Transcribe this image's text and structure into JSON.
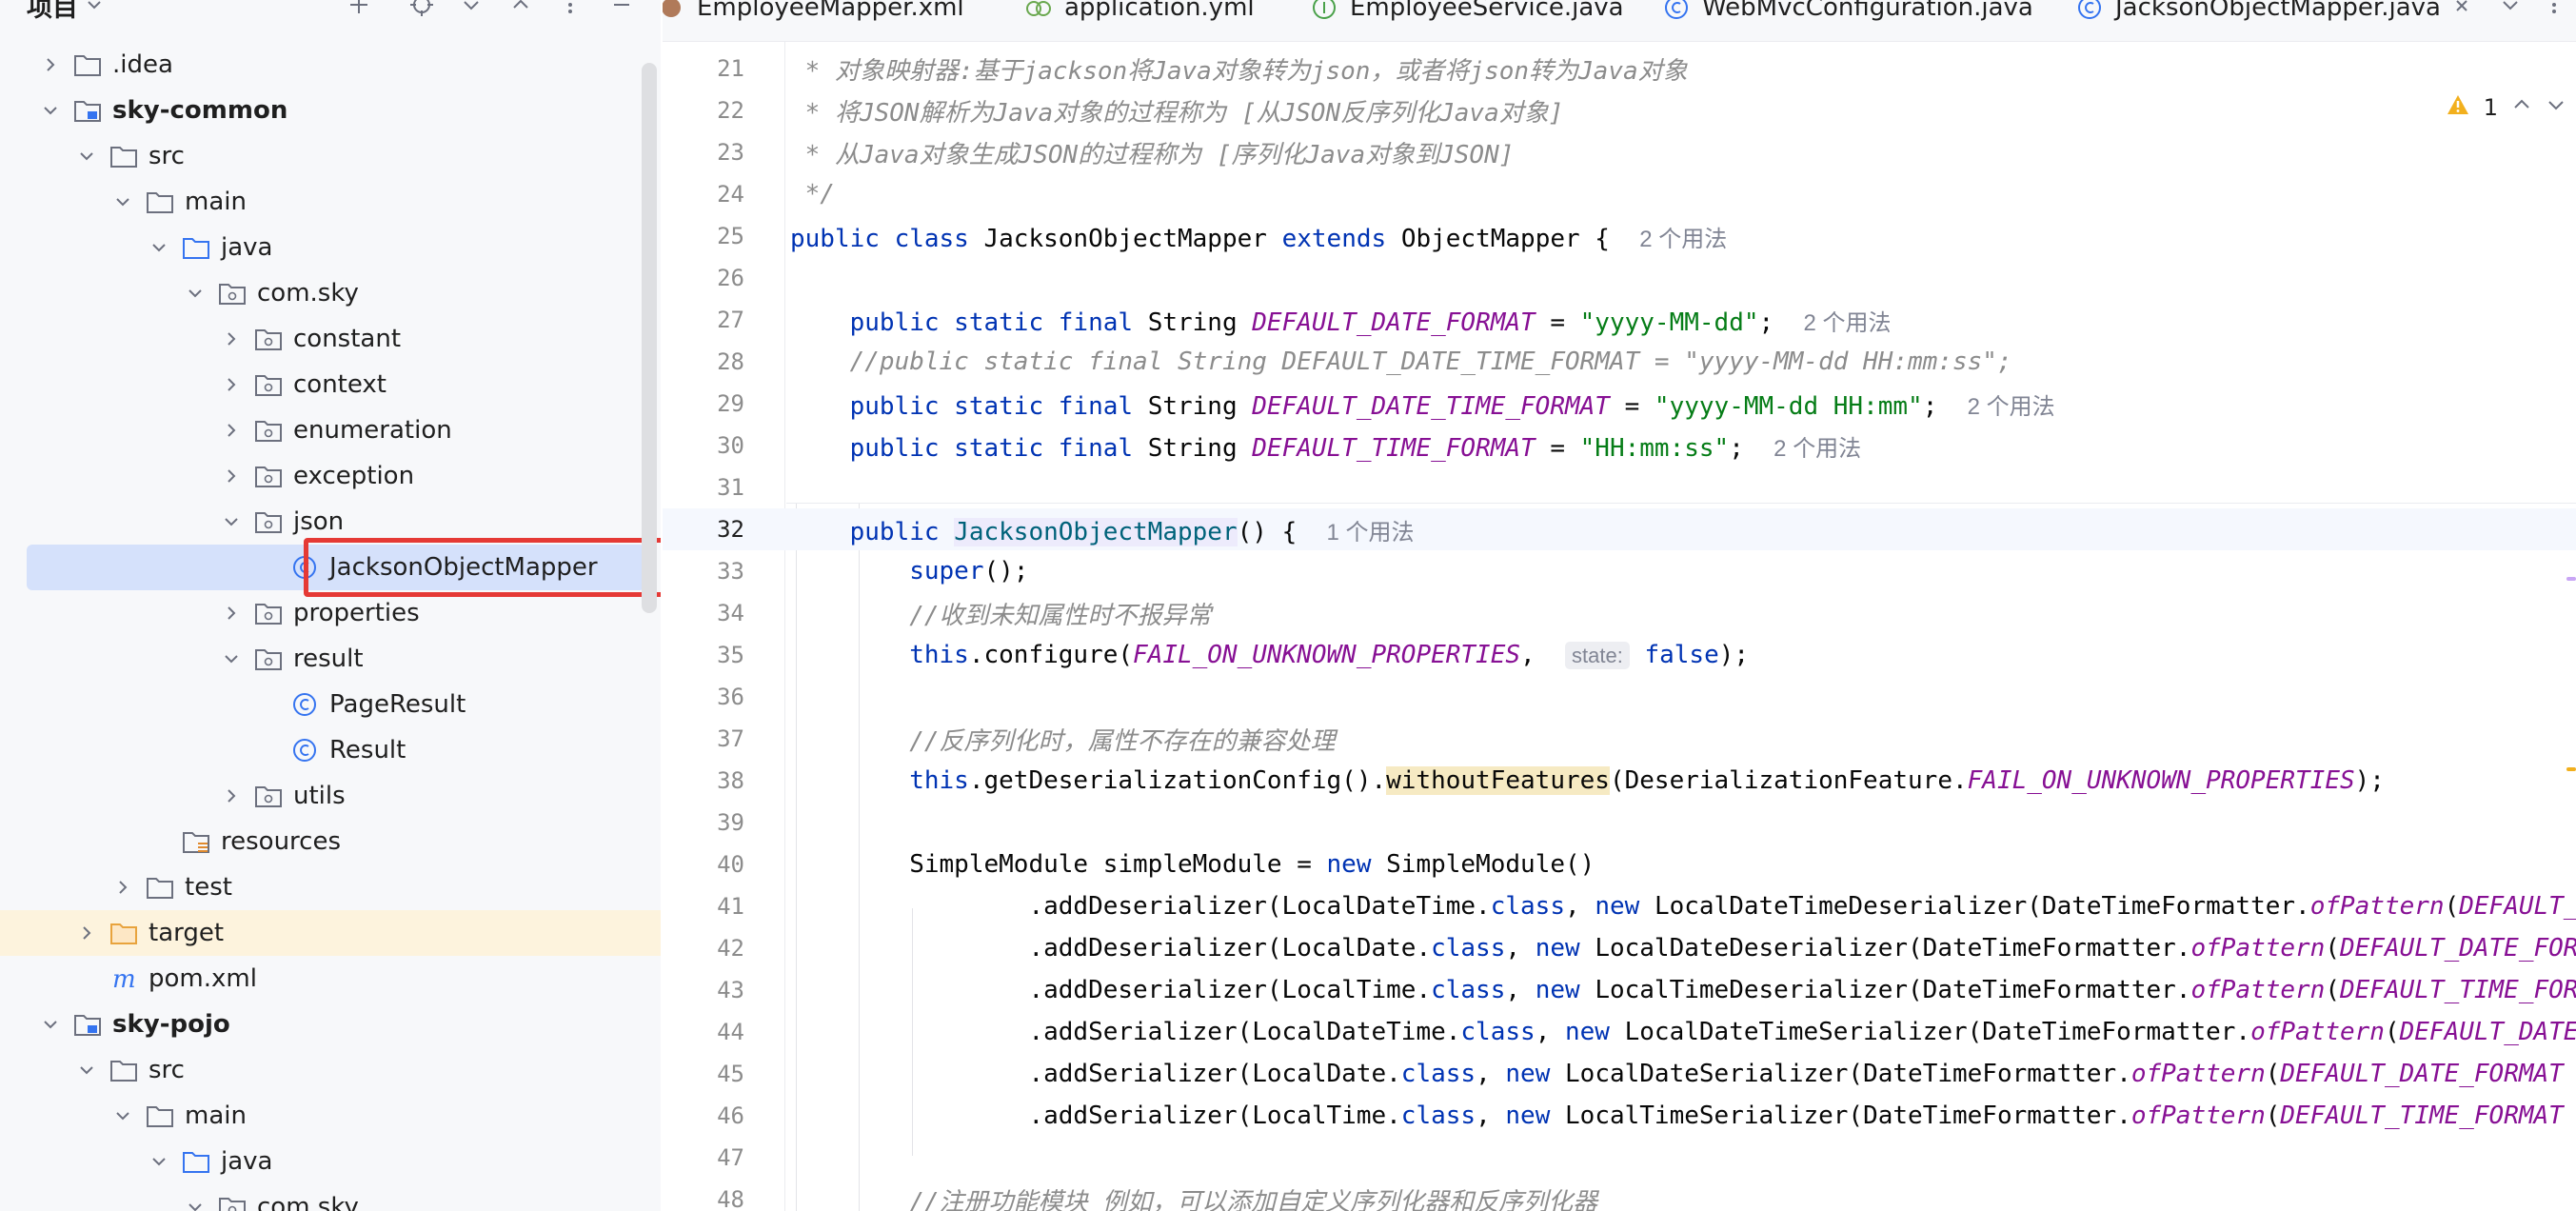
{
  "project_panel": {
    "title": "项目",
    "tree": [
      {
        "label": ".idea",
        "indent": 1,
        "chevron": "right",
        "icon": "folder"
      },
      {
        "label": "sky-common",
        "indent": 1,
        "chevron": "down",
        "icon": "module",
        "bold": true
      },
      {
        "label": "src",
        "indent": 2,
        "chevron": "down",
        "icon": "folder"
      },
      {
        "label": "main",
        "indent": 3,
        "chevron": "down",
        "icon": "folder"
      },
      {
        "label": "java",
        "indent": 4,
        "chevron": "down",
        "icon": "source-folder"
      },
      {
        "label": "com.sky",
        "indent": 5,
        "chevron": "down",
        "icon": "package"
      },
      {
        "label": "constant",
        "indent": 6,
        "chevron": "right",
        "icon": "package"
      },
      {
        "label": "context",
        "indent": 6,
        "chevron": "right",
        "icon": "package"
      },
      {
        "label": "enumeration",
        "indent": 6,
        "chevron": "right",
        "icon": "package"
      },
      {
        "label": "exception",
        "indent": 6,
        "chevron": "right",
        "icon": "package"
      },
      {
        "label": "json",
        "indent": 6,
        "chevron": "down",
        "icon": "package"
      },
      {
        "label": "JacksonObjectMapper",
        "indent": 7,
        "chevron": "none",
        "icon": "class",
        "selected": true
      },
      {
        "label": "properties",
        "indent": 6,
        "chevron": "right",
        "icon": "package"
      },
      {
        "label": "result",
        "indent": 6,
        "chevron": "down",
        "icon": "package"
      },
      {
        "label": "PageResult",
        "indent": 7,
        "chevron": "none",
        "icon": "class"
      },
      {
        "label": "Result",
        "indent": 7,
        "chevron": "none",
        "icon": "class"
      },
      {
        "label": "utils",
        "indent": 6,
        "chevron": "right",
        "icon": "package"
      },
      {
        "label": "resources",
        "indent": 4,
        "chevron": "none",
        "icon": "resources-folder"
      },
      {
        "label": "test",
        "indent": 3,
        "chevron": "right",
        "icon": "folder"
      },
      {
        "label": "target",
        "indent": 2,
        "chevron": "right",
        "icon": "excluded-folder",
        "target": true
      },
      {
        "label": "pom.xml",
        "indent": 2,
        "chevron": "none",
        "icon": "maven"
      },
      {
        "label": "sky-pojo",
        "indent": 1,
        "chevron": "down",
        "icon": "module",
        "bold": true
      },
      {
        "label": "src",
        "indent": 2,
        "chevron": "down",
        "icon": "folder"
      },
      {
        "label": "main",
        "indent": 3,
        "chevron": "down",
        "icon": "folder"
      },
      {
        "label": "java",
        "indent": 4,
        "chevron": "down",
        "icon": "source-folder"
      },
      {
        "label": "com.sky",
        "indent": 5,
        "chevron": "down",
        "icon": "package"
      }
    ]
  },
  "tabs": [
    {
      "label": "EmployeeMapper.xml",
      "icon": "xml-icon"
    },
    {
      "label": "application.yml",
      "icon": "yaml-icon"
    },
    {
      "label": "EmployeeService.java",
      "icon": "interface-icon"
    },
    {
      "label": "WebMvcConfiguration.java",
      "icon": "class-icon"
    },
    {
      "label": "JacksonObjectMapper.java",
      "icon": "class-icon",
      "active": true
    }
  ],
  "editor": {
    "warning_count": "1",
    "current_line": 32,
    "lines": [
      {
        "n": 21,
        "tokens": [
          {
            "t": " * 对象映射器:基于jackson将Java对象转为json，或者将json转为Java对象",
            "c": "cm"
          }
        ]
      },
      {
        "n": 22,
        "tokens": [
          {
            "t": " * 将JSON解析为Java对象的过程称为 [从JSON反序列化Java对象]",
            "c": "cm"
          }
        ]
      },
      {
        "n": 23,
        "tokens": [
          {
            "t": " * 从Java对象生成JSON的过程称为 [序列化Java对象到JSON]",
            "c": "cm"
          }
        ]
      },
      {
        "n": 24,
        "tokens": [
          {
            "t": " */",
            "c": "cm"
          }
        ]
      },
      {
        "n": 25,
        "tokens": [
          {
            "t": "public class ",
            "c": "kw"
          },
          {
            "t": "JacksonObjectMapper "
          },
          {
            "t": "extends ",
            "c": "kw"
          },
          {
            "t": "ObjectMapper {  "
          },
          {
            "t": "2 个用法",
            "c": "hint"
          }
        ]
      },
      {
        "n": 26,
        "tokens": []
      },
      {
        "n": 27,
        "tokens": [
          {
            "t": "    public static final ",
            "c": "kw"
          },
          {
            "t": "String "
          },
          {
            "t": "DEFAULT_DATE_FORMAT",
            "c": "fld"
          },
          {
            "t": " = "
          },
          {
            "t": "\"yyyy-MM-dd\"",
            "c": "str"
          },
          {
            "t": ";  "
          },
          {
            "t": "2 个用法",
            "c": "hint"
          }
        ]
      },
      {
        "n": 28,
        "tokens": [
          {
            "t": "    //public static final String DEFAULT_DATE_TIME_FORMAT = \"yyyy-MM-dd HH:mm:ss\";",
            "c": "cm"
          }
        ]
      },
      {
        "n": 29,
        "tokens": [
          {
            "t": "    public static final ",
            "c": "kw"
          },
          {
            "t": "String "
          },
          {
            "t": "DEFAULT_DATE_TIME_FORMAT",
            "c": "fld"
          },
          {
            "t": " = "
          },
          {
            "t": "\"yyyy-MM-dd HH:mm\"",
            "c": "str"
          },
          {
            "t": ";  "
          },
          {
            "t": "2 个用法",
            "c": "hint"
          }
        ]
      },
      {
        "n": 30,
        "tokens": [
          {
            "t": "    public static final ",
            "c": "kw"
          },
          {
            "t": "String "
          },
          {
            "t": "DEFAULT_TIME_FORMAT",
            "c": "fld"
          },
          {
            "t": " = "
          },
          {
            "t": "\"HH:mm:ss\"",
            "c": "str"
          },
          {
            "t": ";  "
          },
          {
            "t": "2 个用法",
            "c": "hint"
          }
        ]
      },
      {
        "n": 31,
        "tokens": []
      },
      {
        "n": 32,
        "tokens": [
          {
            "t": "    public ",
            "c": "kw"
          },
          {
            "t": "JacksonObjectMapper",
            "c": "mth hl-usage"
          },
          {
            "t": "() {  "
          },
          {
            "t": "1 个用法",
            "c": "hint"
          }
        ]
      },
      {
        "n": 33,
        "tokens": [
          {
            "t": "        super",
            "c": "kw"
          },
          {
            "t": "();"
          }
        ]
      },
      {
        "n": 34,
        "tokens": [
          {
            "t": "        //收到未知属性时不报异常",
            "c": "cm"
          }
        ]
      },
      {
        "n": 35,
        "tokens": [
          {
            "t": "        this",
            "c": "kw"
          },
          {
            "t": ".configure("
          },
          {
            "t": "FAIL_ON_UNKNOWN_PROPERTIES",
            "c": "fld"
          },
          {
            "t": ",  "
          },
          {
            "t": "state:",
            "c": "param-hint"
          },
          {
            "t": " "
          },
          {
            "t": "false",
            "c": "kw"
          },
          {
            "t": ");"
          }
        ]
      },
      {
        "n": 36,
        "tokens": []
      },
      {
        "n": 37,
        "tokens": [
          {
            "t": "        //反序列化时，属性不存在的兼容处理",
            "c": "cm"
          }
        ]
      },
      {
        "n": 38,
        "tokens": [
          {
            "t": "        this",
            "c": "kw"
          },
          {
            "t": ".getDeserializationConfig()."
          },
          {
            "t": "withoutFeatures",
            "c": "hl-warn"
          },
          {
            "t": "(DeserializationFeature."
          },
          {
            "t": "FAIL_ON_UNKNOWN_PROPERTIES",
            "c": "fld"
          },
          {
            "t": ");"
          }
        ]
      },
      {
        "n": 39,
        "tokens": []
      },
      {
        "n": 40,
        "tokens": [
          {
            "t": "        SimpleModule simpleModule = "
          },
          {
            "t": "new ",
            "c": "kw"
          },
          {
            "t": "SimpleModule()"
          }
        ]
      },
      {
        "n": 41,
        "tokens": [
          {
            "t": "                .addDeserializer(LocalDateTime."
          },
          {
            "t": "class",
            "c": "kw"
          },
          {
            "t": ", "
          },
          {
            "t": "new ",
            "c": "kw"
          },
          {
            "t": "LocalDateTimeDeserializer(DateTimeFormatter."
          },
          {
            "t": "ofPattern",
            "c": "fld"
          },
          {
            "t": "("
          },
          {
            "t": "DEFAULT_DATE_TIME_FORMAT",
            "c": "fld"
          }
        ]
      },
      {
        "n": 42,
        "tokens": [
          {
            "t": "                .addDeserializer(LocalDate."
          },
          {
            "t": "class",
            "c": "kw"
          },
          {
            "t": ", "
          },
          {
            "t": "new ",
            "c": "kw"
          },
          {
            "t": "LocalDateDeserializer(DateTimeFormatter."
          },
          {
            "t": "ofPattern",
            "c": "fld"
          },
          {
            "t": "("
          },
          {
            "t": "DEFAULT_DATE_FORMAT",
            "c": "fld"
          }
        ]
      },
      {
        "n": 43,
        "tokens": [
          {
            "t": "                .addDeserializer(LocalTime."
          },
          {
            "t": "class",
            "c": "kw"
          },
          {
            "t": ", "
          },
          {
            "t": "new ",
            "c": "kw"
          },
          {
            "t": "LocalTimeDeserializer(DateTimeFormatter."
          },
          {
            "t": "ofPattern",
            "c": "fld"
          },
          {
            "t": "("
          },
          {
            "t": "DEFAULT_TIME_FORMAT",
            "c": "fld"
          }
        ]
      },
      {
        "n": 44,
        "tokens": [
          {
            "t": "                .addSerializer(LocalDateTime."
          },
          {
            "t": "class",
            "c": "kw"
          },
          {
            "t": ", "
          },
          {
            "t": "new ",
            "c": "kw"
          },
          {
            "t": "LocalDateTimeSerializer(DateTimeFormatter."
          },
          {
            "t": "ofPattern",
            "c": "fld"
          },
          {
            "t": "("
          },
          {
            "t": "DEFAULT_DATE_TIME_FORMAT",
            "c": "fld"
          }
        ]
      },
      {
        "n": 45,
        "tokens": [
          {
            "t": "                .addSerializer(LocalDate."
          },
          {
            "t": "class",
            "c": "kw"
          },
          {
            "t": ", "
          },
          {
            "t": "new ",
            "c": "kw"
          },
          {
            "t": "LocalDateSerializer(DateTimeFormatter."
          },
          {
            "t": "ofPattern",
            "c": "fld"
          },
          {
            "t": "("
          },
          {
            "t": "DEFAULT_DATE_FORMAT",
            "c": "fld"
          }
        ]
      },
      {
        "n": 46,
        "tokens": [
          {
            "t": "                .addSerializer(LocalTime."
          },
          {
            "t": "class",
            "c": "kw"
          },
          {
            "t": ", "
          },
          {
            "t": "new ",
            "c": "kw"
          },
          {
            "t": "LocalTimeSerializer(DateTimeFormatter."
          },
          {
            "t": "ofPattern",
            "c": "fld"
          },
          {
            "t": "("
          },
          {
            "t": "DEFAULT_TIME_FORMAT",
            "c": "fld"
          }
        ]
      },
      {
        "n": 47,
        "tokens": []
      },
      {
        "n": 48,
        "tokens": [
          {
            "t": "        //注册功能模块 例如，可以添加自定义序列化器和反序列化器",
            "c": "cm"
          }
        ]
      }
    ]
  },
  "colors": {
    "accent": "#3574f0",
    "selection": "#d5e1fb",
    "highlight_box": "#e53935",
    "keyword": "#0033b3",
    "string": "#067d17",
    "field": "#871094",
    "comment": "#8c8c8c"
  }
}
